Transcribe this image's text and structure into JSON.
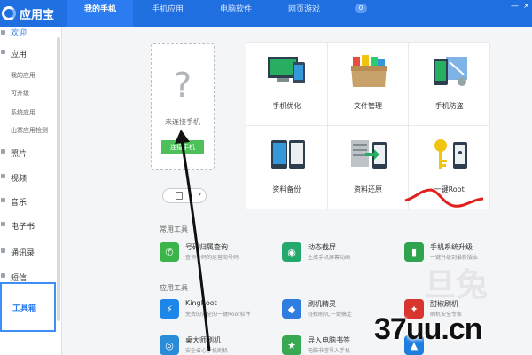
{
  "app": {
    "title": "应用宝"
  },
  "tabs": [
    {
      "label": "我的手机",
      "active": true
    },
    {
      "label": "手机应用",
      "active": false
    },
    {
      "label": "电脑软件",
      "active": false
    },
    {
      "label": "网页游戏",
      "active": false
    }
  ],
  "tab_badge": "0",
  "window_controls": {
    "min": "—",
    "close": "×"
  },
  "sidebar": {
    "welcome": "欢迎",
    "apps": "应用",
    "apps_sub": [
      "我的应用",
      "可升级",
      "系统应用",
      "山寨应用检测"
    ],
    "items": [
      "照片",
      "视频",
      "音乐",
      "电子书",
      "通讯录",
      "短信"
    ],
    "toolbox": "工具箱"
  },
  "phone": {
    "placeholder_glyph": "?",
    "status": "未连接手机",
    "connect_label": "连接手机"
  },
  "tool_grid": [
    {
      "label": "手机优化",
      "icon": "monitor-phone-icon"
    },
    {
      "label": "文件管理",
      "icon": "folder-box-icon"
    },
    {
      "label": "手机防盗",
      "icon": "phone-map-icon"
    },
    {
      "label": "资料备份",
      "icon": "phone-backup-icon"
    },
    {
      "label": "资料还原",
      "icon": "phone-restore-icon"
    },
    {
      "label": "一键Root",
      "icon": "key-phone-icon"
    }
  ],
  "common_tools": {
    "title": "常用工具",
    "items": [
      {
        "name": "号码归属查询",
        "desc": "查询号码的运营商号码",
        "color": "#3bb54a",
        "glyph": "✆"
      },
      {
        "name": "动态截屏",
        "desc": "生成手机屏幕动画",
        "color": "#23a86d",
        "glyph": "◉"
      },
      {
        "name": "手机系统升级",
        "desc": "一键升级到最新版本",
        "color": "#2ea44f",
        "glyph": "▮"
      }
    ]
  },
  "app_tools": {
    "title": "应用工具",
    "items": [
      {
        "name": "KingRoot",
        "desc": "免费的安全的一键Root软件",
        "color": "#1d86e8",
        "glyph": "⚡"
      },
      {
        "name": "刷机精灵",
        "desc": "轻松刷机,一键搞定",
        "color": "#2f7de1",
        "glyph": "◆"
      },
      {
        "name": "甜椒刷机",
        "desc": "刷机安全专家",
        "color": "#d8352f",
        "glyph": "✦"
      },
      {
        "name": "桌大师刷机",
        "desc": "安全省心手机刷机",
        "color": "#2a8cd6",
        "glyph": "◎"
      },
      {
        "name": "导入电脑书签",
        "desc": "电脑书签导入手机",
        "color": "#39a852",
        "glyph": "★"
      },
      {
        "name": "",
        "desc": "",
        "color": "#1c7fe0",
        "glyph": "▲"
      }
    ]
  },
  "watermark": "37uu.cn",
  "watermark_faint": "旦兔",
  "colors": {
    "brand": "#1f6fe0",
    "connect": "#4cc159",
    "highlight": "#3e8ef7",
    "scribble": "#e0201c"
  }
}
